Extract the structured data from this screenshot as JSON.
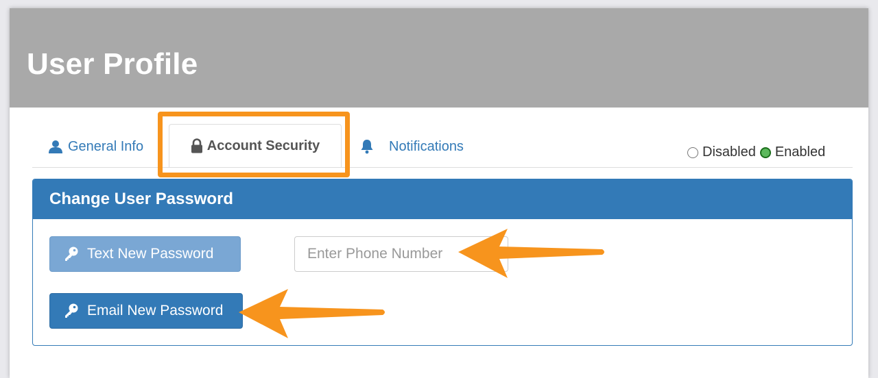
{
  "header": {
    "title": "User Profile"
  },
  "tabs": [
    {
      "label": "General Info",
      "icon": "user-icon",
      "active": false
    },
    {
      "label": "Account Security",
      "icon": "lock-icon",
      "active": true
    },
    {
      "label": "Notifications",
      "icon": "bell-icon",
      "active": false
    }
  ],
  "toggle": {
    "options": [
      {
        "label": "Disabled",
        "checked": false
      },
      {
        "label": "Enabled",
        "checked": true
      }
    ]
  },
  "panel": {
    "title": "Change User Password",
    "text_button_label": "Text New Password",
    "email_button_label": "Email New Password",
    "phone_input": {
      "value": "",
      "placeholder": "Enter Phone Number"
    }
  },
  "colors": {
    "header_bg": "#a9a9a9",
    "primary": "#337ab7",
    "primary_light": "#7aa7d4",
    "highlight": "#f7941d",
    "enabled_green": "#5cb85c"
  }
}
